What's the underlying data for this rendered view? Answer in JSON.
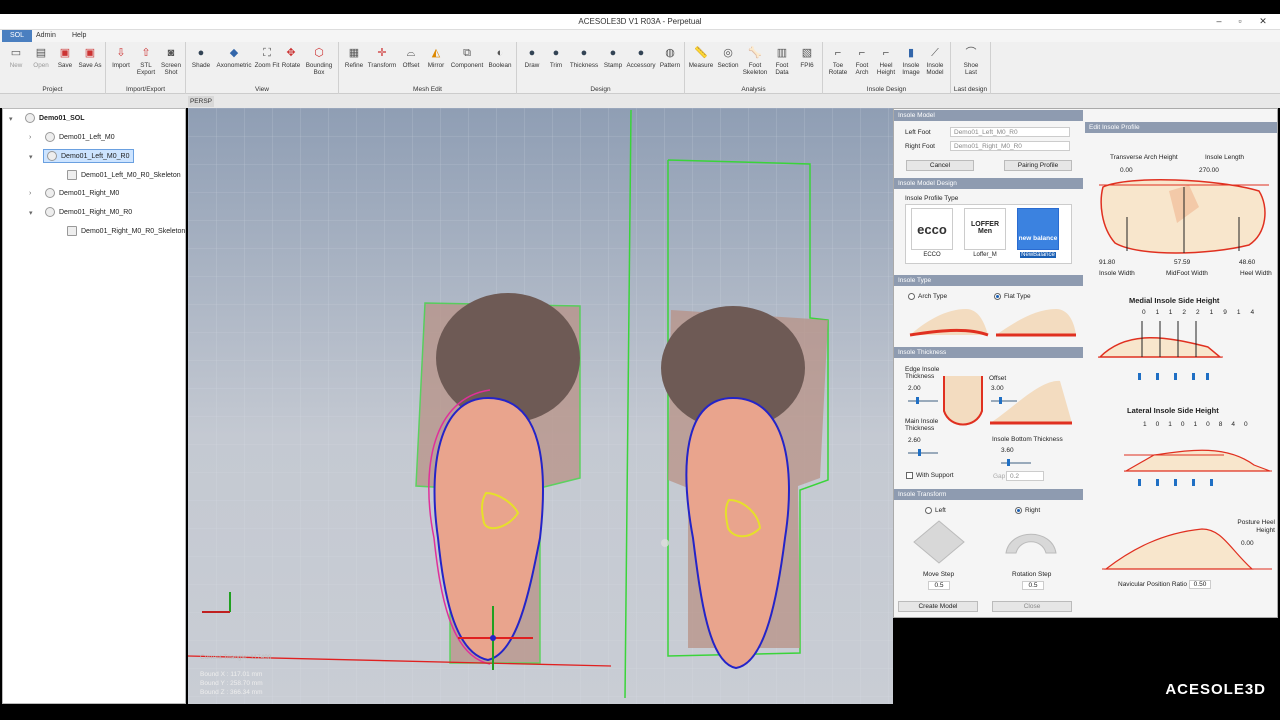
{
  "window": {
    "title": "ACESOLE3D V1 R03A - Perpetual"
  },
  "menu": [
    "SOL",
    "Admin",
    "Help"
  ],
  "ribbon": {
    "groups": [
      {
        "label": "Project",
        "tools": [
          "New",
          "Open",
          "Save",
          "Save As"
        ]
      },
      {
        "label": "Import/Export",
        "tools": [
          "Import",
          "STL Export",
          "Screen Shot"
        ]
      },
      {
        "label": "View",
        "tools": [
          "Shade",
          "Axonometric",
          "Zoom Fit",
          "Rotate",
          "Bounding Box"
        ]
      },
      {
        "label": "Mesh Edit",
        "tools": [
          "Refine",
          "Transform",
          "Offset",
          "Mirror",
          "Component",
          "Boolean"
        ]
      },
      {
        "label": "Design",
        "tools": [
          "Draw",
          "Trim",
          "Thickness",
          "Stamp",
          "Accessory",
          "Pattern"
        ]
      },
      {
        "label": "Analysis",
        "tools": [
          "Measure",
          "Section",
          "Foot Skeleton",
          "Foot Data",
          "FPI6"
        ]
      },
      {
        "label": "Insole Design",
        "tools": [
          "Toe Rotate",
          "Foot Arch",
          "Heel Height",
          "Insole Image",
          "Insole Model"
        ]
      },
      {
        "label": "Last design",
        "tools": [
          "Shoe Last"
        ]
      }
    ]
  },
  "tree": {
    "root": "Demo01_SOL",
    "items": [
      "Demo01_Left_M0",
      "Demo01_Left_M0_R0",
      "Demo01_Left_M0_R0_Skeleton",
      "Demo01_Right_M0",
      "Demo01_Right_M0_R0",
      "Demo01_Right_M0_R0_Skeleton"
    ]
  },
  "viewport": {
    "tab": "PERSP",
    "current": "Current Triangle: 117498",
    "bound_x": "Bound X : 117.01 mm",
    "bound_y": "Bound Y : 258.70 mm",
    "bound_z": "Bound Z : 366.34 mm"
  },
  "insole_model": {
    "header": "Insole Model",
    "left_foot_label": "Left Foot",
    "left_foot": "Demo01_Left_M0_R0",
    "right_foot_label": "Right Foot",
    "right_foot": "Demo01_Right_M0_R0",
    "cancel": "Cancel",
    "pairing": "Pairing Profile",
    "design_header": "Insole Model Design",
    "profile_type_label": "Insole Profile Type",
    "brands": [
      {
        "logo": "ecco",
        "name": "ECCO"
      },
      {
        "logo": "LOFFER Men",
        "name": "Loffer_M"
      },
      {
        "logo": "new balance",
        "name": "NewBalance"
      }
    ],
    "type_header": "Insole Type",
    "arch_type": "Arch Type",
    "flat_type": "Flat Type",
    "thickness_header": "Insole Thickness",
    "edge_label": "Edge Insole Thickness",
    "edge_val": "2.00",
    "offset_label": "Offset",
    "offset_val": "3.00",
    "main_label": "Main Insole Thickness",
    "main_val": "2.60",
    "bottom_label": "Insole Bottom Thickness",
    "bottom_val": "3.60",
    "with_support": "With Support",
    "gap_label": "Gap",
    "gap_val": "0.2",
    "transform_header": "Insole Transform",
    "left": "Left",
    "right": "Right",
    "move_step": "Move Step",
    "move_val": "0.5",
    "rot_step": "Rotation Step",
    "rot_val": "0.5",
    "create": "Create Model",
    "close": "Close"
  },
  "edit_profile": {
    "header": "Edit Insole Profile",
    "transverse": "Transverse Arch Height",
    "transverse_val": "0.00",
    "length": "Insole Length",
    "length_val": "270.00",
    "width_label": "Insole Width",
    "width_val": "91.80",
    "midfoot_label": "MidFoot Width",
    "midfoot_val": "57.59",
    "heel_label": "Heel Width",
    "heel_val": "48.60",
    "medial_title": "Medial Insole Side Height",
    "medial_vals": [
      "0",
      "11",
      "22",
      "19",
      "14"
    ],
    "lateral_title": "Lateral Insole Side Height",
    "lateral_vals": [
      "10",
      "10",
      "10",
      "8",
      "4",
      "0"
    ],
    "posture": "Posture Heel Height",
    "posture_val": "0.00",
    "navicular": "Navicular Position Ratio",
    "navicular_val": "0.50"
  },
  "logo": "ACESOLE3D"
}
